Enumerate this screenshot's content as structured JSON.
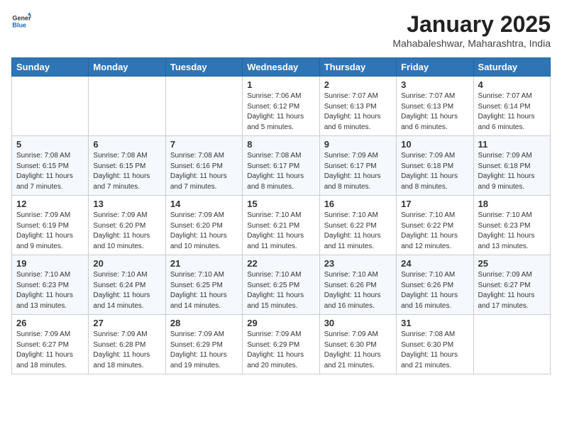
{
  "header": {
    "logo_general": "General",
    "logo_blue": "Blue",
    "month": "January 2025",
    "location": "Mahabaleshwar, Maharashtra, India"
  },
  "days_of_week": [
    "Sunday",
    "Monday",
    "Tuesday",
    "Wednesday",
    "Thursday",
    "Friday",
    "Saturday"
  ],
  "weeks": [
    [
      {
        "day": "",
        "info": ""
      },
      {
        "day": "",
        "info": ""
      },
      {
        "day": "",
        "info": ""
      },
      {
        "day": "1",
        "info": "Sunrise: 7:06 AM\nSunset: 6:12 PM\nDaylight: 11 hours and 5 minutes."
      },
      {
        "day": "2",
        "info": "Sunrise: 7:07 AM\nSunset: 6:13 PM\nDaylight: 11 hours and 6 minutes."
      },
      {
        "day": "3",
        "info": "Sunrise: 7:07 AM\nSunset: 6:13 PM\nDaylight: 11 hours and 6 minutes."
      },
      {
        "day": "4",
        "info": "Sunrise: 7:07 AM\nSunset: 6:14 PM\nDaylight: 11 hours and 6 minutes."
      }
    ],
    [
      {
        "day": "5",
        "info": "Sunrise: 7:08 AM\nSunset: 6:15 PM\nDaylight: 11 hours and 7 minutes."
      },
      {
        "day": "6",
        "info": "Sunrise: 7:08 AM\nSunset: 6:15 PM\nDaylight: 11 hours and 7 minutes."
      },
      {
        "day": "7",
        "info": "Sunrise: 7:08 AM\nSunset: 6:16 PM\nDaylight: 11 hours and 7 minutes."
      },
      {
        "day": "8",
        "info": "Sunrise: 7:08 AM\nSunset: 6:17 PM\nDaylight: 11 hours and 8 minutes."
      },
      {
        "day": "9",
        "info": "Sunrise: 7:09 AM\nSunset: 6:17 PM\nDaylight: 11 hours and 8 minutes."
      },
      {
        "day": "10",
        "info": "Sunrise: 7:09 AM\nSunset: 6:18 PM\nDaylight: 11 hours and 8 minutes."
      },
      {
        "day": "11",
        "info": "Sunrise: 7:09 AM\nSunset: 6:18 PM\nDaylight: 11 hours and 9 minutes."
      }
    ],
    [
      {
        "day": "12",
        "info": "Sunrise: 7:09 AM\nSunset: 6:19 PM\nDaylight: 11 hours and 9 minutes."
      },
      {
        "day": "13",
        "info": "Sunrise: 7:09 AM\nSunset: 6:20 PM\nDaylight: 11 hours and 10 minutes."
      },
      {
        "day": "14",
        "info": "Sunrise: 7:09 AM\nSunset: 6:20 PM\nDaylight: 11 hours and 10 minutes."
      },
      {
        "day": "15",
        "info": "Sunrise: 7:10 AM\nSunset: 6:21 PM\nDaylight: 11 hours and 11 minutes."
      },
      {
        "day": "16",
        "info": "Sunrise: 7:10 AM\nSunset: 6:22 PM\nDaylight: 11 hours and 11 minutes."
      },
      {
        "day": "17",
        "info": "Sunrise: 7:10 AM\nSunset: 6:22 PM\nDaylight: 11 hours and 12 minutes."
      },
      {
        "day": "18",
        "info": "Sunrise: 7:10 AM\nSunset: 6:23 PM\nDaylight: 11 hours and 13 minutes."
      }
    ],
    [
      {
        "day": "19",
        "info": "Sunrise: 7:10 AM\nSunset: 6:23 PM\nDaylight: 11 hours and 13 minutes."
      },
      {
        "day": "20",
        "info": "Sunrise: 7:10 AM\nSunset: 6:24 PM\nDaylight: 11 hours and 14 minutes."
      },
      {
        "day": "21",
        "info": "Sunrise: 7:10 AM\nSunset: 6:25 PM\nDaylight: 11 hours and 14 minutes."
      },
      {
        "day": "22",
        "info": "Sunrise: 7:10 AM\nSunset: 6:25 PM\nDaylight: 11 hours and 15 minutes."
      },
      {
        "day": "23",
        "info": "Sunrise: 7:10 AM\nSunset: 6:26 PM\nDaylight: 11 hours and 16 minutes."
      },
      {
        "day": "24",
        "info": "Sunrise: 7:10 AM\nSunset: 6:26 PM\nDaylight: 11 hours and 16 minutes."
      },
      {
        "day": "25",
        "info": "Sunrise: 7:09 AM\nSunset: 6:27 PM\nDaylight: 11 hours and 17 minutes."
      }
    ],
    [
      {
        "day": "26",
        "info": "Sunrise: 7:09 AM\nSunset: 6:27 PM\nDaylight: 11 hours and 18 minutes."
      },
      {
        "day": "27",
        "info": "Sunrise: 7:09 AM\nSunset: 6:28 PM\nDaylight: 11 hours and 18 minutes."
      },
      {
        "day": "28",
        "info": "Sunrise: 7:09 AM\nSunset: 6:29 PM\nDaylight: 11 hours and 19 minutes."
      },
      {
        "day": "29",
        "info": "Sunrise: 7:09 AM\nSunset: 6:29 PM\nDaylight: 11 hours and 20 minutes."
      },
      {
        "day": "30",
        "info": "Sunrise: 7:09 AM\nSunset: 6:30 PM\nDaylight: 11 hours and 21 minutes."
      },
      {
        "day": "31",
        "info": "Sunrise: 7:08 AM\nSunset: 6:30 PM\nDaylight: 11 hours and 21 minutes."
      },
      {
        "day": "",
        "info": ""
      }
    ]
  ]
}
